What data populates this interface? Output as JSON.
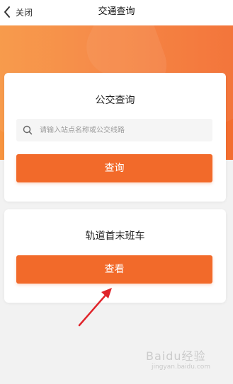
{
  "nav": {
    "close_label": "关闭",
    "title": "交通查询"
  },
  "bus_query": {
    "title": "公交查询",
    "search_placeholder": "请输入站点名称或公交线路",
    "button_label": "查询"
  },
  "rail_schedule": {
    "title": "轨道首末班车",
    "button_label": "查看"
  },
  "watermark": {
    "text": "Baidu经验",
    "url": "jingyan.baidu.com"
  },
  "colors": {
    "accent": "#f26a2a",
    "hero_start": "#f7943f",
    "hero_end": "#f36d2f",
    "annotation_arrow": "#e0242a"
  }
}
